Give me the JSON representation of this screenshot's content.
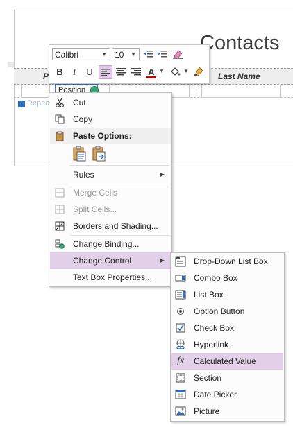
{
  "form": {
    "title": "Contacts",
    "column_header_first": "P",
    "column_header_last_name": "Last Name",
    "control_text": "Position",
    "repeat_label": "Repea"
  },
  "mini_toolbar": {
    "font_name": "Calibri",
    "font_size": "10",
    "bold_label": "B",
    "italic_label": "I",
    "underline_label": "U",
    "font_color_label": "A",
    "highlight_color": "#c00000",
    "active_button_color": "#e2c9ea"
  },
  "context_menu": {
    "items": [
      {
        "label": "Cut",
        "icon": "scissors-icon",
        "enabled": true
      },
      {
        "label": "Copy",
        "icon": "copy-icon",
        "enabled": true
      },
      {
        "label": "Paste Options:",
        "icon": "paste-icon",
        "section_header": true
      },
      {
        "label": "Rules",
        "submenu": true,
        "enabled": true
      },
      {
        "label": "Merge Cells",
        "icon": "merge-cells-icon",
        "enabled": false
      },
      {
        "label": "Split Cells...",
        "icon": "split-cells-icon",
        "enabled": false
      },
      {
        "label": "Borders and Shading...",
        "icon": "borders-icon",
        "enabled": true
      },
      {
        "label": "Change Binding...",
        "icon": "binding-icon",
        "enabled": true
      },
      {
        "label": "Change Control",
        "submenu": true,
        "highlighted": true
      },
      {
        "label": "Text Box Properties...",
        "enabled": true
      }
    ]
  },
  "submenu": {
    "items": [
      {
        "label": "Drop-Down List Box",
        "icon": "dropdown-list-icon"
      },
      {
        "label": "Combo Box",
        "icon": "combo-box-icon"
      },
      {
        "label": "List Box",
        "icon": "list-box-icon"
      },
      {
        "label": "Option Button",
        "icon": "option-button-icon"
      },
      {
        "label": "Check Box",
        "icon": "check-box-icon"
      },
      {
        "label": "Hyperlink",
        "icon": "hyperlink-icon"
      },
      {
        "label": "Calculated Value",
        "icon": "fx-icon",
        "highlighted": true
      },
      {
        "label": "Section",
        "icon": "section-icon"
      },
      {
        "label": "Date Picker",
        "icon": "date-picker-icon"
      },
      {
        "label": "Picture",
        "icon": "picture-icon"
      }
    ]
  },
  "colors": {
    "highlight": "#e2cfe8",
    "control_border": "#2b7de0"
  }
}
